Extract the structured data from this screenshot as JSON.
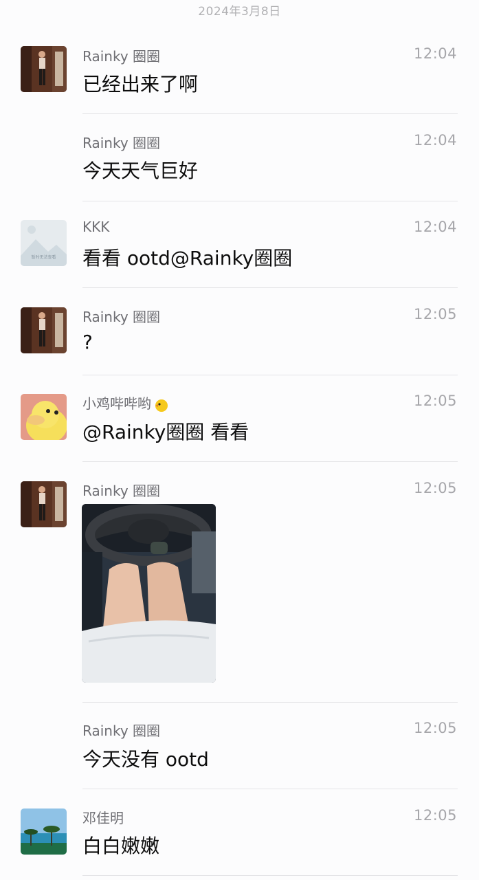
{
  "chat": {
    "date_header": "2024年3月8日",
    "messages": [
      {
        "sender": "Rainky 圈圈",
        "time": "12:04",
        "text": "已经出来了啊",
        "avatar": "photo-woman-avatar"
      },
      {
        "sender": "Rainky 圈圈",
        "time": "12:04",
        "text": "今天天气巨好",
        "avatar": ""
      },
      {
        "sender": "KKK",
        "time": "12:04",
        "text": "看看 ootd@Rainky圈圈",
        "avatar": "placeholder-landscape-avatar",
        "avatar_caption": "暂时无法查看"
      },
      {
        "sender": "Rainky 圈圈",
        "time": "12:05",
        "text": "?",
        "avatar": "photo-woman-avatar"
      },
      {
        "sender": "小鸡哔哔哟",
        "time": "12:05",
        "text": "@Rainky圈圈 看看",
        "avatar": "yellow-duck-avatar",
        "sender_emoji": "chick-emoji"
      },
      {
        "sender": "Rainky 圈圈",
        "time": "12:05",
        "text": "",
        "avatar": "photo-woman-avatar",
        "image": "car-interior-photo"
      },
      {
        "sender": "Rainky 圈圈",
        "time": "12:05",
        "text": "今天没有 ootd",
        "avatar": ""
      },
      {
        "sender": "邓佳明",
        "time": "12:05",
        "text": "白白嫩嫩",
        "avatar": "beach-palm-avatar"
      }
    ]
  },
  "colors": {
    "background": "#fcfcfd",
    "sender_text": "#6e6e73",
    "time_text": "#a6a6aa",
    "divider": "#e3e3e6"
  }
}
